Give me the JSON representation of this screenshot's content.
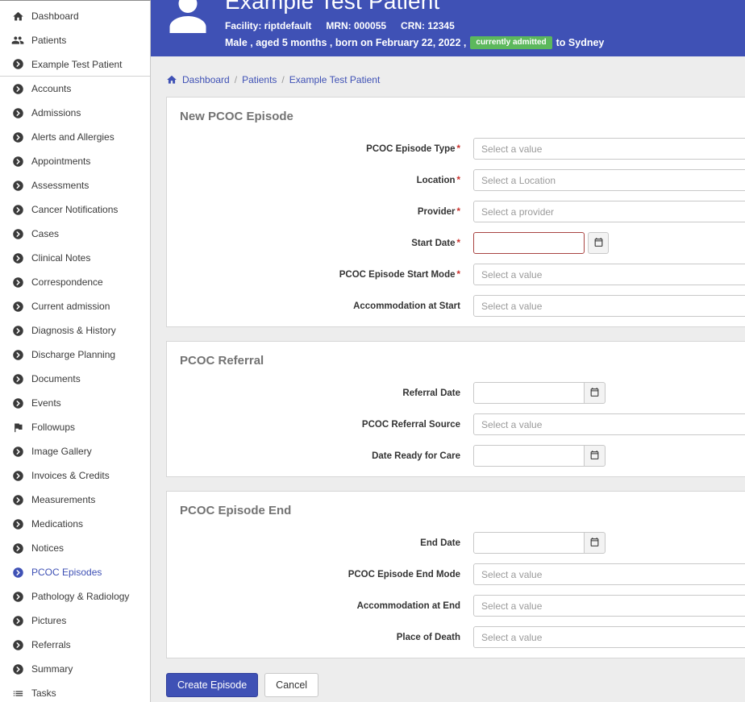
{
  "colors": {
    "primary": "#3f51b5",
    "badge_green": "#5cb85c",
    "required": "#c9302c",
    "error_border": "#a94442"
  },
  "sidebar": {
    "items": [
      {
        "label": "Dashboard",
        "icon": "home"
      },
      {
        "label": "Patients",
        "icon": "people"
      },
      {
        "label": "Example Test Patient",
        "icon": "chevron",
        "divider_after": true
      },
      {
        "label": "Accounts",
        "icon": "chevron"
      },
      {
        "label": "Admissions",
        "icon": "chevron"
      },
      {
        "label": "Alerts and Allergies",
        "icon": "chevron"
      },
      {
        "label": "Appointments",
        "icon": "chevron"
      },
      {
        "label": "Assessments",
        "icon": "chevron"
      },
      {
        "label": "Cancer Notifications",
        "icon": "chevron"
      },
      {
        "label": "Cases",
        "icon": "chevron"
      },
      {
        "label": "Clinical Notes",
        "icon": "chevron"
      },
      {
        "label": "Correspondence",
        "icon": "chevron"
      },
      {
        "label": "Current admission",
        "icon": "chevron"
      },
      {
        "label": "Diagnosis & History",
        "icon": "chevron"
      },
      {
        "label": "Discharge Planning",
        "icon": "chevron"
      },
      {
        "label": "Documents",
        "icon": "chevron"
      },
      {
        "label": "Events",
        "icon": "chevron"
      },
      {
        "label": "Followups",
        "icon": "flag"
      },
      {
        "label": "Image Gallery",
        "icon": "chevron"
      },
      {
        "label": "Invoices & Credits",
        "icon": "chevron"
      },
      {
        "label": "Measurements",
        "icon": "chevron"
      },
      {
        "label": "Medications",
        "icon": "chevron"
      },
      {
        "label": "Notices",
        "icon": "chevron"
      },
      {
        "label": "PCOC Episodes",
        "icon": "chevron",
        "active": true
      },
      {
        "label": "Pathology & Radiology",
        "icon": "chevron"
      },
      {
        "label": "Pictures",
        "icon": "chevron"
      },
      {
        "label": "Referrals",
        "icon": "chevron"
      },
      {
        "label": "Summary",
        "icon": "chevron"
      },
      {
        "label": "Tasks",
        "icon": "list"
      }
    ]
  },
  "header": {
    "title": "Example Test Patient",
    "facility": "Facility: riptdefault",
    "mrn": "MRN: 000055",
    "crn": "CRN: 12345",
    "demographics": "Male , aged 5 months , born on February 22, 2022 ,",
    "admission_badge": "currently admitted",
    "admission_suffix": "to Sydney"
  },
  "breadcrumb": {
    "items": [
      "Dashboard",
      "Patients",
      "Example Test Patient"
    ],
    "separator": "/"
  },
  "sections": [
    {
      "title": "New PCOC Episode",
      "fields": [
        {
          "label": "PCOC Episode Type",
          "required": true,
          "type": "select",
          "placeholder": "Select a value"
        },
        {
          "label": "Location",
          "required": true,
          "type": "select",
          "placeholder": "Select a Location"
        },
        {
          "label": "Provider",
          "required": true,
          "type": "select",
          "placeholder": "Select a provider"
        },
        {
          "label": "Start Date",
          "required": true,
          "type": "date",
          "value": "",
          "error": true
        },
        {
          "label": "PCOC Episode Start Mode",
          "required": true,
          "type": "select",
          "placeholder": "Select a value"
        },
        {
          "label": "Accommodation at Start",
          "required": false,
          "type": "select",
          "placeholder": "Select a value"
        }
      ]
    },
    {
      "title": "PCOC Referral",
      "fields": [
        {
          "label": "Referral Date",
          "required": false,
          "type": "date",
          "value": ""
        },
        {
          "label": "PCOC Referral Source",
          "required": false,
          "type": "select",
          "placeholder": "Select a value"
        },
        {
          "label": "Date Ready for Care",
          "required": false,
          "type": "date",
          "value": ""
        }
      ]
    },
    {
      "title": "PCOC Episode End",
      "fields": [
        {
          "label": "End Date",
          "required": false,
          "type": "date",
          "value": ""
        },
        {
          "label": "PCOC Episode End Mode",
          "required": false,
          "type": "select",
          "placeholder": "Select a value"
        },
        {
          "label": "Accommodation at End",
          "required": false,
          "type": "select",
          "placeholder": "Select a value"
        },
        {
          "label": "Place of Death",
          "required": false,
          "type": "select",
          "placeholder": "Select a value"
        }
      ]
    }
  ],
  "actions": {
    "create": "Create Episode",
    "cancel": "Cancel"
  }
}
